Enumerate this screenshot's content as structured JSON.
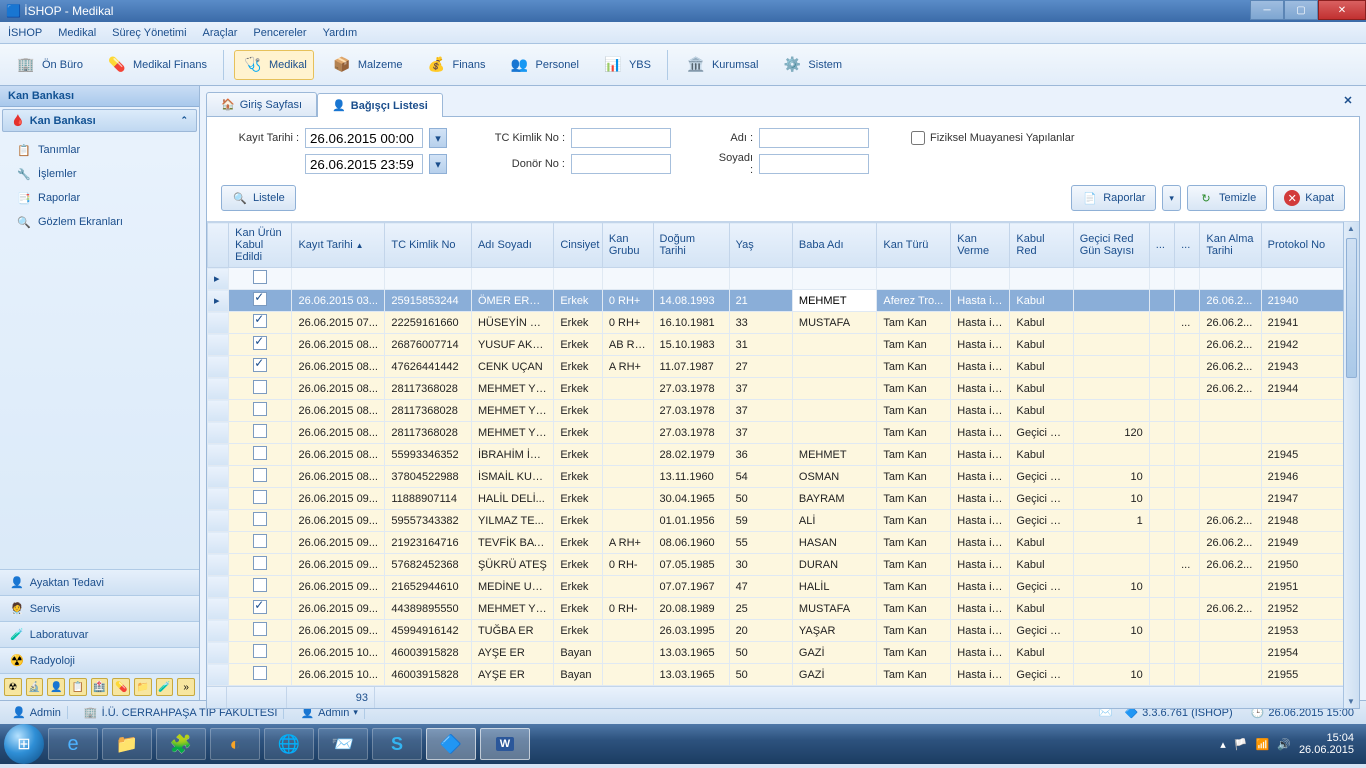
{
  "window": {
    "title": "İSHOP - Medikal"
  },
  "menu": [
    "İSHOP",
    "Medikal",
    "Süreç Yönetimi",
    "Araçlar",
    "Pencereler",
    "Yardım"
  ],
  "ribbon": [
    {
      "label": "Ön Büro",
      "icon": "🏢"
    },
    {
      "label": "Medikal Finans",
      "icon": "💊"
    },
    {
      "label": "Medikal",
      "icon": "🩺",
      "active": true
    },
    {
      "label": "Malzeme",
      "icon": "📦"
    },
    {
      "label": "Finans",
      "icon": "💰"
    },
    {
      "label": "Personel",
      "icon": "👥"
    },
    {
      "label": "YBS",
      "icon": "📊"
    },
    {
      "label": "Kurumsal",
      "icon": "🏛️"
    },
    {
      "label": "Sistem",
      "icon": "⚙️"
    }
  ],
  "sidebar": {
    "header": "Kan Bankası",
    "group": "Kan Bankası",
    "items": [
      {
        "label": "Tanımlar",
        "icon": "📋"
      },
      {
        "label": "İşlemler",
        "icon": "🔧"
      },
      {
        "label": "Raporlar",
        "icon": "📑"
      },
      {
        "label": "Gözlem Ekranları",
        "icon": "🔍"
      }
    ],
    "tiles": [
      {
        "label": "Ayaktan Tedavi",
        "icon": "👤"
      },
      {
        "label": "Servis",
        "icon": "🧑‍⚕️"
      },
      {
        "label": "Laboratuvar",
        "icon": "🧪"
      },
      {
        "label": "Radyoloji",
        "icon": "☢️"
      }
    ]
  },
  "tabs": [
    {
      "label": "Giriş Sayfası",
      "icon": "🏠"
    },
    {
      "label": "Bağışçı Listesi",
      "icon": "👤",
      "active": true
    }
  ],
  "filters": {
    "kayit_tarihi_label": "Kayıt Tarihi :",
    "date_from": "26.06.2015 00:00",
    "date_to": "26.06.2015 23:59",
    "tc_label": "TC Kimlik No :",
    "tc_value": "",
    "donor_label": "Donör No :",
    "donor_value": "",
    "adi_label": "Adı :",
    "adi_value": "",
    "soyadi_label": "Soyadı :",
    "soyadi_value": "",
    "fiziksel_label": "Fiziksel Muayanesi Yapılanlar"
  },
  "buttons": {
    "listele": "Listele",
    "raporlar": "Raporlar",
    "temizle": "Temizle",
    "kapat": "Kapat"
  },
  "columns": [
    "",
    "Kan Ürün Kabul Edildi",
    "Kayıt Tarihi",
    "TC Kimlik No",
    "Adı Soyadı",
    "Cinsiyet",
    "Kan Grubu",
    "Doğum Tarihi",
    "Yaş",
    "Baba Adı",
    "Kan Türü",
    "Kan Verme",
    "Kabul Red",
    "Geçici Red Gün Sayısı",
    "...",
    "...",
    "Kan Alma Tarihi",
    "Protokol No"
  ],
  "rows": [
    {
      "sel": true,
      "chk": true,
      "tarih": "26.06.2015 03...",
      "tc": "25915853244",
      "ad": "ÖMER ERSÜ...",
      "cin": "Erkek",
      "kg": "0 RH+",
      "dt": "14.08.1993",
      "yas": "21",
      "baba": "MEHMET",
      "tur": "Aferez Tro...",
      "verme": "Hasta için",
      "kabul": "Kabul",
      "red": "",
      "d1": "",
      "d2": "",
      "alma": "26.06.2...",
      "prot": "21940"
    },
    {
      "chk": true,
      "tarih": "26.06.2015 07...",
      "tc": "22259161660",
      "ad": "HÜSEYİN M...",
      "cin": "Erkek",
      "kg": "0 RH+",
      "dt": "16.10.1981",
      "yas": "33",
      "baba": "MUSTAFA",
      "tur": "Tam Kan",
      "verme": "Hasta için",
      "kabul": "Kabul",
      "red": "",
      "d1": "",
      "d2": "...",
      "alma": "26.06.2...",
      "prot": "21941"
    },
    {
      "chk": true,
      "tarih": "26.06.2015 08...",
      "tc": "26876007714",
      "ad": "YUSUF AKSOY",
      "cin": "Erkek",
      "kg": "AB RH+",
      "dt": "15.10.1983",
      "yas": "31",
      "baba": "",
      "tur": "Tam Kan",
      "verme": "Hasta için",
      "kabul": "Kabul",
      "red": "",
      "d1": "",
      "d2": "",
      "alma": "26.06.2...",
      "prot": "21942"
    },
    {
      "chk": true,
      "tarih": "26.06.2015 08...",
      "tc": "47626441442",
      "ad": "CENK UÇAN",
      "cin": "Erkek",
      "kg": "A RH+",
      "dt": "11.07.1987",
      "yas": "27",
      "baba": "",
      "tur": "Tam Kan",
      "verme": "Hasta için",
      "kabul": "Kabul",
      "red": "",
      "d1": "",
      "d2": "",
      "alma": "26.06.2...",
      "prot": "21943"
    },
    {
      "chk": false,
      "tarih": "26.06.2015 08...",
      "tc": "28117368028",
      "ad": "MEHMET Yİ...",
      "cin": "Erkek",
      "kg": "",
      "dt": "27.03.1978",
      "yas": "37",
      "baba": "",
      "tur": "Tam Kan",
      "verme": "Hasta için",
      "kabul": "Kabul",
      "red": "",
      "d1": "",
      "d2": "",
      "alma": "26.06.2...",
      "prot": "21944"
    },
    {
      "chk": false,
      "tarih": "26.06.2015 08...",
      "tc": "28117368028",
      "ad": "MEHMET Yİ...",
      "cin": "Erkek",
      "kg": "",
      "dt": "27.03.1978",
      "yas": "37",
      "baba": "",
      "tur": "Tam Kan",
      "verme": "Hasta için",
      "kabul": "Kabul",
      "red": "",
      "d1": "",
      "d2": "",
      "alma": "",
      "prot": ""
    },
    {
      "chk": false,
      "tarih": "26.06.2015 08...",
      "tc": "28117368028",
      "ad": "MEHMET Yİ...",
      "cin": "Erkek",
      "kg": "",
      "dt": "27.03.1978",
      "yas": "37",
      "baba": "",
      "tur": "Tam Kan",
      "verme": "Hasta için",
      "kabul": "Geçici Red",
      "red": "120",
      "d1": "",
      "d2": "",
      "alma": "",
      "prot": ""
    },
    {
      "chk": false,
      "tarih": "26.06.2015 08...",
      "tc": "55993346352",
      "ad": "İBRAHİM İÇEN",
      "cin": "Erkek",
      "kg": "",
      "dt": "28.02.1979",
      "yas": "36",
      "baba": "MEHMET",
      "tur": "Tam Kan",
      "verme": "Hasta için",
      "kabul": "Kabul",
      "red": "",
      "d1": "",
      "d2": "",
      "alma": "",
      "prot": "21945"
    },
    {
      "chk": false,
      "tarih": "26.06.2015 08...",
      "tc": "37804522988",
      "ad": "İSMAİL KUR...",
      "cin": "Erkek",
      "kg": "",
      "dt": "13.11.1960",
      "yas": "54",
      "baba": "OSMAN",
      "tur": "Tam Kan",
      "verme": "Hasta için",
      "kabul": "Geçici Red",
      "red": "10",
      "d1": "",
      "d2": "",
      "alma": "",
      "prot": "21946"
    },
    {
      "chk": false,
      "tarih": "26.06.2015 09...",
      "tc": "11888907114",
      "ad": "HALİL DELİ...",
      "cin": "Erkek",
      "kg": "",
      "dt": "30.04.1965",
      "yas": "50",
      "baba": "BAYRAM",
      "tur": "Tam Kan",
      "verme": "Hasta için",
      "kabul": "Geçici Red",
      "red": "10",
      "d1": "",
      "d2": "",
      "alma": "",
      "prot": "21947"
    },
    {
      "chk": false,
      "tarih": "26.06.2015 09...",
      "tc": "59557343382",
      "ad": "YILMAZ TE...",
      "cin": "Erkek",
      "kg": "",
      "dt": "01.01.1956",
      "yas": "59",
      "baba": "ALİ",
      "tur": "Tam Kan",
      "verme": "Hasta için",
      "kabul": "Geçici Red",
      "red": "1",
      "d1": "",
      "d2": "",
      "alma": "26.06.2...",
      "prot": "21948"
    },
    {
      "chk": false,
      "tarih": "26.06.2015 09...",
      "tc": "21923164716",
      "ad": "TEVFİK BAY...",
      "cin": "Erkek",
      "kg": "A RH+",
      "dt": "08.06.1960",
      "yas": "55",
      "baba": "HASAN",
      "tur": "Tam Kan",
      "verme": "Hasta için",
      "kabul": "Kabul",
      "red": "",
      "d1": "",
      "d2": "",
      "alma": "26.06.2...",
      "prot": "21949"
    },
    {
      "chk": false,
      "tarih": "26.06.2015 09...",
      "tc": "57682452368",
      "ad": "ŞÜKRÜ ATEŞ",
      "cin": "Erkek",
      "kg": "0 RH-",
      "dt": "07.05.1985",
      "yas": "30",
      "baba": "DURAN",
      "tur": "Tam Kan",
      "verme": "Hasta için",
      "kabul": "Kabul",
      "red": "",
      "d1": "",
      "d2": "...",
      "alma": "26.06.2...",
      "prot": "21950"
    },
    {
      "chk": false,
      "tarih": "26.06.2015 09...",
      "tc": "21652944610",
      "ad": "MEDİNE UZ...",
      "cin": "Erkek",
      "kg": "",
      "dt": "07.07.1967",
      "yas": "47",
      "baba": "HALİL",
      "tur": "Tam Kan",
      "verme": "Hasta için",
      "kabul": "Geçici Red",
      "red": "10",
      "d1": "",
      "d2": "",
      "alma": "",
      "prot": "21951"
    },
    {
      "chk": true,
      "tarih": "26.06.2015 09...",
      "tc": "44389895550",
      "ad": "MEHMET Yİ...",
      "cin": "Erkek",
      "kg": "0 RH-",
      "dt": "20.08.1989",
      "yas": "25",
      "baba": "MUSTAFA",
      "tur": "Tam Kan",
      "verme": "Hasta için",
      "kabul": "Kabul",
      "red": "",
      "d1": "",
      "d2": "",
      "alma": "26.06.2...",
      "prot": "21952"
    },
    {
      "chk": false,
      "tarih": "26.06.2015 09...",
      "tc": "45994916142",
      "ad": "TUĞBA ER",
      "cin": "Erkek",
      "kg": "",
      "dt": "26.03.1995",
      "yas": "20",
      "baba": "YAŞAR",
      "tur": "Tam Kan",
      "verme": "Hasta için",
      "kabul": "Geçici Red",
      "red": "10",
      "d1": "",
      "d2": "",
      "alma": "",
      "prot": "21953"
    },
    {
      "chk": false,
      "tarih": "26.06.2015 10...",
      "tc": "46003915828",
      "ad": "AYŞE ER",
      "cin": "Bayan",
      "kg": "",
      "dt": "13.03.1965",
      "yas": "50",
      "baba": "GAZİ",
      "tur": "Tam Kan",
      "verme": "Hasta için",
      "kabul": "Kabul",
      "red": "",
      "d1": "",
      "d2": "",
      "alma": "",
      "prot": "21954"
    },
    {
      "chk": false,
      "tarih": "26.06.2015 10...",
      "tc": "46003915828",
      "ad": "AYŞE ER",
      "cin": "Bayan",
      "kg": "",
      "dt": "13.03.1965",
      "yas": "50",
      "baba": "GAZİ",
      "tur": "Tam Kan",
      "verme": "Hasta için",
      "kabul": "Geçici Red",
      "red": "10",
      "d1": "",
      "d2": "",
      "alma": "",
      "prot": "21955"
    }
  ],
  "footer_count": "93",
  "status": {
    "user": "Admin",
    "org": "İ.Ü. CERRAHPAŞA TIP FAKÜLTESİ",
    "role": "Admin",
    "version": "3.3.6.761 (ISHOP)",
    "datetime": "26.06.2015 15:00"
  },
  "taskbar": {
    "time": "15:04",
    "date": "26.06.2015"
  }
}
